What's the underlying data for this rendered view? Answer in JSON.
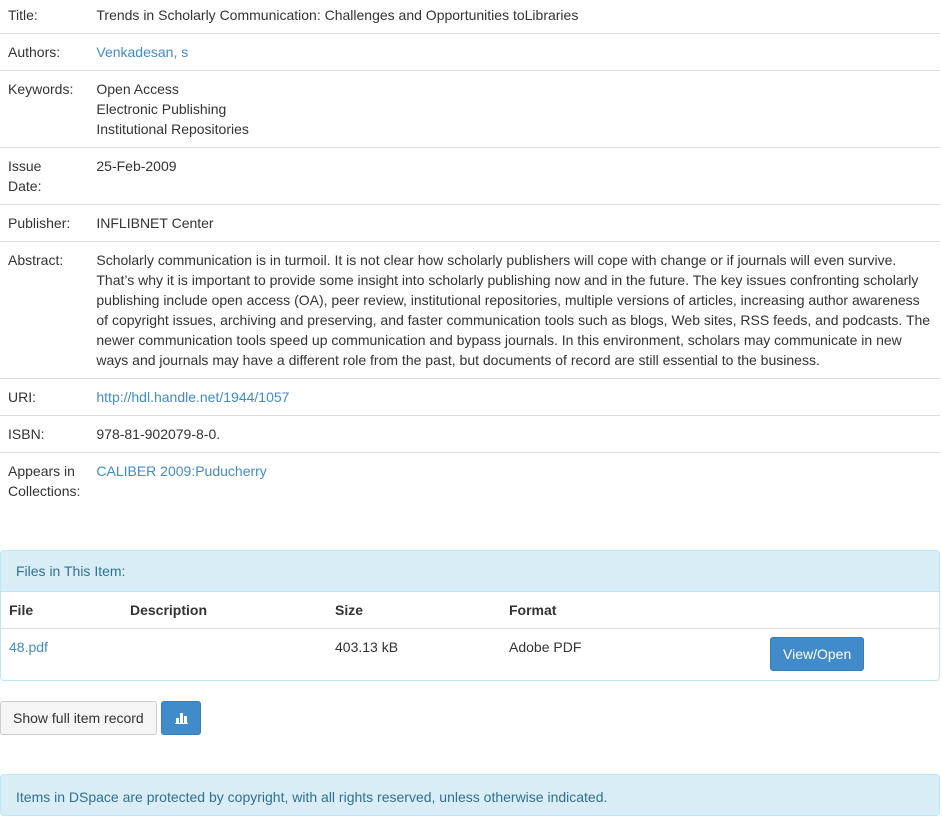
{
  "metadata": {
    "title_label": "Title:",
    "title_value": "Trends in Scholarly Communication: Challenges and Opportunities toLibraries",
    "authors_label": "Authors:",
    "authors_value": "Venkadesan, s",
    "keywords_label": "Keywords:",
    "keywords": [
      "Open Access",
      "Electronic Publishing",
      "Institutional Repositories"
    ],
    "issue_date_label_line1": "Issue",
    "issue_date_label_line2": "Date:",
    "issue_date_value": "25-Feb-2009",
    "publisher_label": "Publisher:",
    "publisher_value": "INFLIBNET Center",
    "abstract_label": "Abstract:",
    "abstract_value": "Scholarly communication is in turmoil. It is not clear how scholarly publishers will cope with change or if journals will even survive. That’s why it is important to provide some insight into scholarly publishing now and in the future. The key issues confronting scholarly publishing include open access (OA), peer review, institutional repositories, multiple versions of articles, increasing author awareness of copyright issues, archiving and preserving, and faster communication tools such as blogs, Web sites, RSS feeds, and podcasts. The newer communication tools speed up communication and bypass journals. In this environment, scholars may communicate in new ways and journals may have a different role from the past, but documents of record are still essential to the business.",
    "uri_label": "URI:",
    "uri_value": "http://hdl.handle.net/1944/1057",
    "isbn_label": "ISBN:",
    "isbn_value": "978-81-902079-8-0.",
    "collections_label_line1": "Appears in",
    "collections_label_line2": "Collections:",
    "collections_value": "CALIBER 2009:Puducherry"
  },
  "files": {
    "heading": "Files in This Item:",
    "columns": {
      "file": "File",
      "description": "Description",
      "size": "Size",
      "format": "Format"
    },
    "rows": [
      {
        "file": "48.pdf",
        "description": "",
        "size": "403.13 kB",
        "format": "Adobe PDF",
        "action": "View/Open"
      }
    ]
  },
  "actions": {
    "show_full_record": "Show full item record",
    "stats_icon": "bar-chart-icon"
  },
  "footer": {
    "copyright": "Items in DSpace are protected by copyright, with all rights reserved, unless otherwise indicated."
  },
  "colors": {
    "link": "#428bca",
    "primary_button": "#428bca",
    "info_panel_bg": "#d9edf7",
    "info_panel_text": "#31708f"
  }
}
